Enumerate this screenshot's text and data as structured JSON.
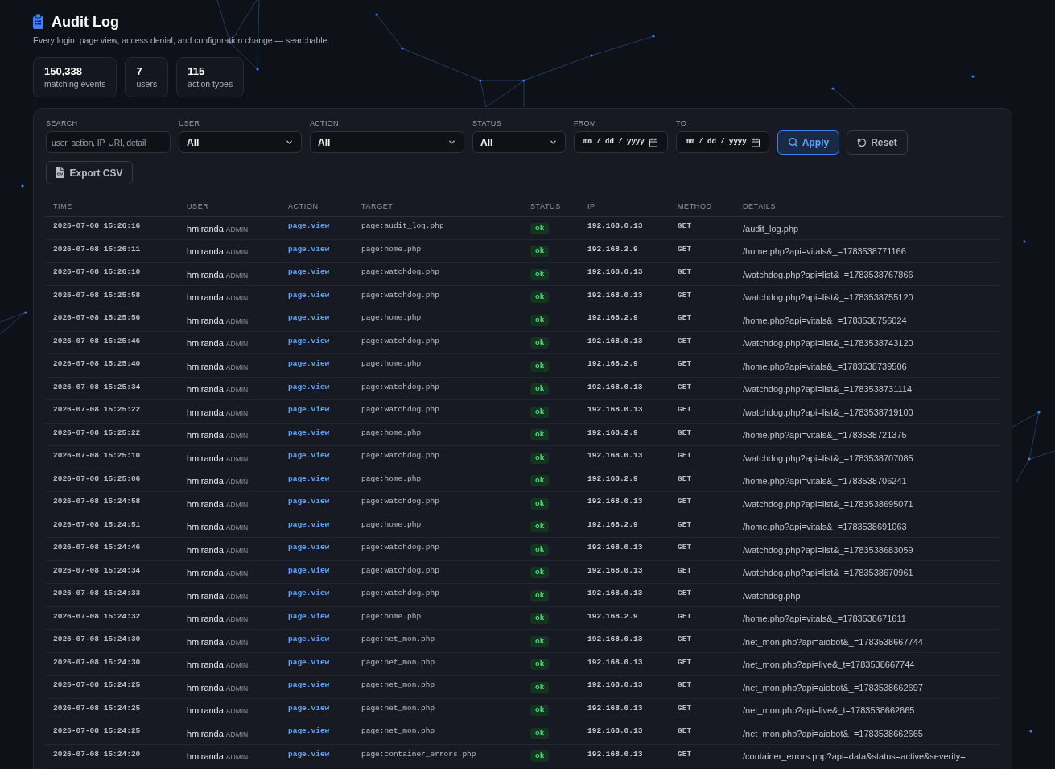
{
  "header": {
    "title": "Audit Log",
    "subtitle": "Every login, page view, access denial, and configuration change — searchable."
  },
  "stats": [
    {
      "value": "150,338",
      "label": "matching events"
    },
    {
      "value": "7",
      "label": "users"
    },
    {
      "value": "115",
      "label": "action types"
    }
  ],
  "filters": [
    {
      "kind": "text",
      "label": "SEARCH",
      "placeholder": "user, action, IP, URI, detail"
    },
    {
      "kind": "select",
      "label": "USER",
      "value": "All"
    },
    {
      "kind": "select",
      "label": "ACTION",
      "value": "All"
    },
    {
      "kind": "select",
      "label": "STATUS",
      "value": "All"
    },
    {
      "kind": "date",
      "label": "FROM",
      "placeholder": "mm / dd / yyyy"
    },
    {
      "kind": "date",
      "label": "TO",
      "placeholder": "mm / dd / yyyy"
    }
  ],
  "buttons": [
    {
      "kind": "primary",
      "label": "Apply"
    },
    {
      "kind": "secondary",
      "label": "Reset"
    }
  ],
  "export_button": {
    "label": "Export CSV"
  },
  "table": {
    "columns": [
      "TIME",
      "USER",
      "ACTION",
      "TARGET",
      "STATUS",
      "IP",
      "METHOD",
      "DETAILS"
    ],
    "rows": [
      {
        "time": "2026-07-08 15:26:16",
        "user": "hmiranda",
        "role": "ADMIN",
        "action": "page.view",
        "target": "page:audit_log.php",
        "status": "ok",
        "ip": "192.168.0.13",
        "method": "GET",
        "details": "/audit_log.php"
      },
      {
        "time": "2026-07-08 15:26:11",
        "user": "hmiranda",
        "role": "ADMIN",
        "action": "page.view",
        "target": "page:home.php",
        "status": "ok",
        "ip": "192.168.2.9",
        "method": "GET",
        "details": "/home.php?api=vitals&_=1783538771166"
      },
      {
        "time": "2026-07-08 15:26:10",
        "user": "hmiranda",
        "role": "ADMIN",
        "action": "page.view",
        "target": "page:watchdog.php",
        "status": "ok",
        "ip": "192.168.0.13",
        "method": "GET",
        "details": "/watchdog.php?api=list&_=1783538767866"
      },
      {
        "time": "2026-07-08 15:25:58",
        "user": "hmiranda",
        "role": "ADMIN",
        "action": "page.view",
        "target": "page:watchdog.php",
        "status": "ok",
        "ip": "192.168.0.13",
        "method": "GET",
        "details": "/watchdog.php?api=list&_=1783538755120"
      },
      {
        "time": "2026-07-08 15:25:56",
        "user": "hmiranda",
        "role": "ADMIN",
        "action": "page.view",
        "target": "page:home.php",
        "status": "ok",
        "ip": "192.168.2.9",
        "method": "GET",
        "details": "/home.php?api=vitals&_=1783538756024"
      },
      {
        "time": "2026-07-08 15:25:46",
        "user": "hmiranda",
        "role": "ADMIN",
        "action": "page.view",
        "target": "page:watchdog.php",
        "status": "ok",
        "ip": "192.168.0.13",
        "method": "GET",
        "details": "/watchdog.php?api=list&_=1783538743120"
      },
      {
        "time": "2026-07-08 15:25:40",
        "user": "hmiranda",
        "role": "ADMIN",
        "action": "page.view",
        "target": "page:home.php",
        "status": "ok",
        "ip": "192.168.2.9",
        "method": "GET",
        "details": "/home.php?api=vitals&_=1783538739506"
      },
      {
        "time": "2026-07-08 15:25:34",
        "user": "hmiranda",
        "role": "ADMIN",
        "action": "page.view",
        "target": "page:watchdog.php",
        "status": "ok",
        "ip": "192.168.0.13",
        "method": "GET",
        "details": "/watchdog.php?api=list&_=1783538731114"
      },
      {
        "time": "2026-07-08 15:25:22",
        "user": "hmiranda",
        "role": "ADMIN",
        "action": "page.view",
        "target": "page:watchdog.php",
        "status": "ok",
        "ip": "192.168.0.13",
        "method": "GET",
        "details": "/watchdog.php?api=list&_=1783538719100"
      },
      {
        "time": "2026-07-08 15:25:22",
        "user": "hmiranda",
        "role": "ADMIN",
        "action": "page.view",
        "target": "page:home.php",
        "status": "ok",
        "ip": "192.168.2.9",
        "method": "GET",
        "details": "/home.php?api=vitals&_=1783538721375"
      },
      {
        "time": "2026-07-08 15:25:10",
        "user": "hmiranda",
        "role": "ADMIN",
        "action": "page.view",
        "target": "page:watchdog.php",
        "status": "ok",
        "ip": "192.168.0.13",
        "method": "GET",
        "details": "/watchdog.php?api=list&_=1783538707085"
      },
      {
        "time": "2026-07-08 15:25:06",
        "user": "hmiranda",
        "role": "ADMIN",
        "action": "page.view",
        "target": "page:home.php",
        "status": "ok",
        "ip": "192.168.2.9",
        "method": "GET",
        "details": "/home.php?api=vitals&_=1783538706241"
      },
      {
        "time": "2026-07-08 15:24:58",
        "user": "hmiranda",
        "role": "ADMIN",
        "action": "page.view",
        "target": "page:watchdog.php",
        "status": "ok",
        "ip": "192.168.0.13",
        "method": "GET",
        "details": "/watchdog.php?api=list&_=1783538695071"
      },
      {
        "time": "2026-07-08 15:24:51",
        "user": "hmiranda",
        "role": "ADMIN",
        "action": "page.view",
        "target": "page:home.php",
        "status": "ok",
        "ip": "192.168.2.9",
        "method": "GET",
        "details": "/home.php?api=vitals&_=1783538691063"
      },
      {
        "time": "2026-07-08 15:24:46",
        "user": "hmiranda",
        "role": "ADMIN",
        "action": "page.view",
        "target": "page:watchdog.php",
        "status": "ok",
        "ip": "192.168.0.13",
        "method": "GET",
        "details": "/watchdog.php?api=list&_=1783538683059"
      },
      {
        "time": "2026-07-08 15:24:34",
        "user": "hmiranda",
        "role": "ADMIN",
        "action": "page.view",
        "target": "page:watchdog.php",
        "status": "ok",
        "ip": "192.168.0.13",
        "method": "GET",
        "details": "/watchdog.php?api=list&_=1783538670961"
      },
      {
        "time": "2026-07-08 15:24:33",
        "user": "hmiranda",
        "role": "ADMIN",
        "action": "page.view",
        "target": "page:watchdog.php",
        "status": "ok",
        "ip": "192.168.0.13",
        "method": "GET",
        "details": "/watchdog.php"
      },
      {
        "time": "2026-07-08 15:24:32",
        "user": "hmiranda",
        "role": "ADMIN",
        "action": "page.view",
        "target": "page:home.php",
        "status": "ok",
        "ip": "192.168.2.9",
        "method": "GET",
        "details": "/home.php?api=vitals&_=1783538671611"
      },
      {
        "time": "2026-07-08 15:24:30",
        "user": "hmiranda",
        "role": "ADMIN",
        "action": "page.view",
        "target": "page:net_mon.php",
        "status": "ok",
        "ip": "192.168.0.13",
        "method": "GET",
        "details": "/net_mon.php?api=aiobot&_=1783538667744"
      },
      {
        "time": "2026-07-08 15:24:30",
        "user": "hmiranda",
        "role": "ADMIN",
        "action": "page.view",
        "target": "page:net_mon.php",
        "status": "ok",
        "ip": "192.168.0.13",
        "method": "GET",
        "details": "/net_mon.php?api=live&_t=1783538667744"
      },
      {
        "time": "2026-07-08 15:24:25",
        "user": "hmiranda",
        "role": "ADMIN",
        "action": "page.view",
        "target": "page:net_mon.php",
        "status": "ok",
        "ip": "192.168.0.13",
        "method": "GET",
        "details": "/net_mon.php?api=aiobot&_=1783538662697"
      },
      {
        "time": "2026-07-08 15:24:25",
        "user": "hmiranda",
        "role": "ADMIN",
        "action": "page.view",
        "target": "page:net_mon.php",
        "status": "ok",
        "ip": "192.168.0.13",
        "method": "GET",
        "details": "/net_mon.php?api=live&_t=1783538662665"
      },
      {
        "time": "2026-07-08 15:24:25",
        "user": "hmiranda",
        "role": "ADMIN",
        "action": "page.view",
        "target": "page:net_mon.php",
        "status": "ok",
        "ip": "192.168.0.13",
        "method": "GET",
        "details": "/net_mon.php?api=aiobot&_=1783538662665"
      },
      {
        "time": "2026-07-08 15:24:20",
        "user": "hmiranda",
        "role": "ADMIN",
        "action": "page.view",
        "target": "page:container_errors.php",
        "status": "ok",
        "ip": "192.168.0.13",
        "method": "GET",
        "details": "/container_errors.php?api=data&status=active&severity="
      }
    ]
  }
}
